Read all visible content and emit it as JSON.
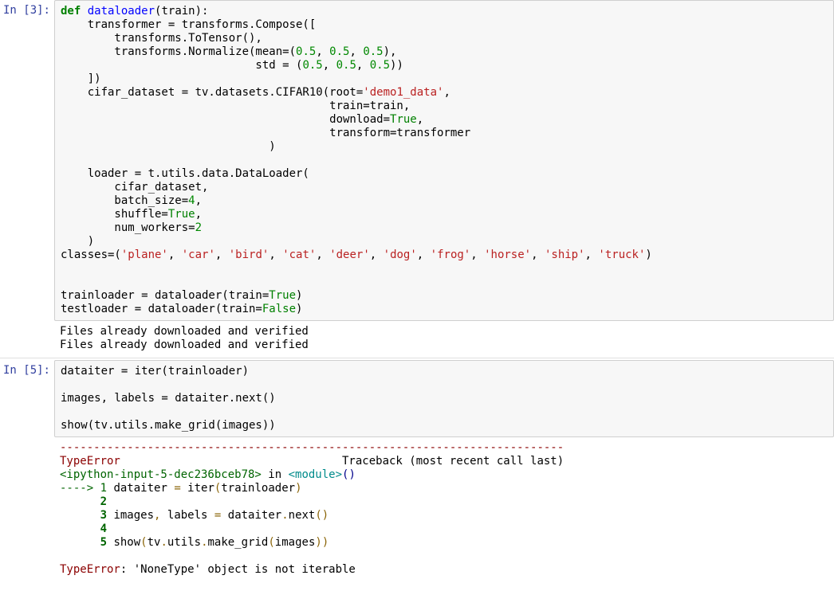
{
  "cell1": {
    "prompt": "In [3]:",
    "code": {
      "l1": {
        "def": "def",
        "fn": "dataloader",
        "rest": "(train):"
      },
      "l2": "    transformer = transforms.Compose([",
      "l3": "        transforms.ToTensor(),",
      "l4a": "        transforms.Normalize(mean=(",
      "l4b": "0.5",
      "l4c": ", ",
      "l4d": "0.5",
      "l4e": ", ",
      "l4f": "0.5",
      "l4g": "),",
      "l5a": "                             std = (",
      "l5b": "0.5",
      "l5c": ", ",
      "l5d": "0.5",
      "l5e": ", ",
      "l5f": "0.5",
      "l5g": "))",
      "l6": "    ])",
      "l7a": "    cifar_dataset = tv.datasets.CIFAR10(root=",
      "l7b": "'demo1_data'",
      "l7c": ",",
      "l8": "                                        train=train,",
      "l9a": "                                        download=",
      "l9b": "True",
      "l9c": ",",
      "l10": "                                        transform=transformer",
      "l11": "                               )",
      "l12": "",
      "l13": "    loader = t.utils.data.DataLoader(",
      "l14": "        cifar_dataset,",
      "l15a": "        batch_size=",
      "l15b": "4",
      "l15c": ",",
      "l16a": "        shuffle=",
      "l16b": "True",
      "l16c": ",",
      "l17a": "        num_workers=",
      "l17b": "2",
      "l18": "    )",
      "l19a": "classes=(",
      "l19s1": "'plane'",
      "l19s2": "'car'",
      "l19s3": "'bird'",
      "l19s4": "'cat'",
      "l19s5": "'deer'",
      "l19s6": "'dog'",
      "l19s7": "'frog'",
      "l19s8": "'horse'",
      "l19s9": "'ship'",
      "l19s10": "'truck'",
      "l19sep": ", ",
      "l19end": ")",
      "l20": "",
      "l21a": "trainloader = dataloader(train=",
      "l21b": "True",
      "l21c": ")",
      "l22a": "testloader = dataloader(train=",
      "l22b": "False",
      "l22c": ")"
    },
    "output": "Files already downloaded and verified\nFiles already downloaded and verified"
  },
  "cell2": {
    "prompt": "In [5]:",
    "code": {
      "l1": "dataiter = iter(trainloader)",
      "l2": "",
      "l3": "images, labels = dataiter.next()",
      "l4": "",
      "l5": "show(tv.utils.make_grid(images))"
    },
    "tb": {
      "dashes": "---------------------------------------------------------------------------",
      "err": "TypeError",
      "traceTxt": "                                 Traceback (most recent call last)",
      "loc1": "<ipython-input-5-dec236bceb78>",
      "in": " in ",
      "loc2": "<module>",
      "loc3": "()",
      "arrow": "----> 1",
      "l1a": " dataiter ",
      "l1b": "=",
      "l1c": " iter",
      "l1d": "(",
      "l1e": "trainloader",
      "l1f": ")",
      "n2": "      2",
      "n2txt": " ",
      "n3": "      3",
      "l3a": " images",
      "l3b": ",",
      "l3c": " labels ",
      "l3d": "=",
      "l3e": " dataiter",
      "l3f": ".",
      "l3g": "next",
      "l3h": "(",
      "l3i": ")",
      "n4": "      4",
      "n4txt": " ",
      "n5": "      5",
      "l5a": " show",
      "l5b": "(",
      "l5c": "tv",
      "l5d": ".",
      "l5e": "utils",
      "l5f": ".",
      "l5g": "make_grid",
      "l5h": "(",
      "l5i": "images",
      "l5j": ")",
      "l5k": ")",
      "blank": "",
      "errname": "TypeError",
      "errmsg": ": 'NoneType' object is not iterable"
    }
  }
}
